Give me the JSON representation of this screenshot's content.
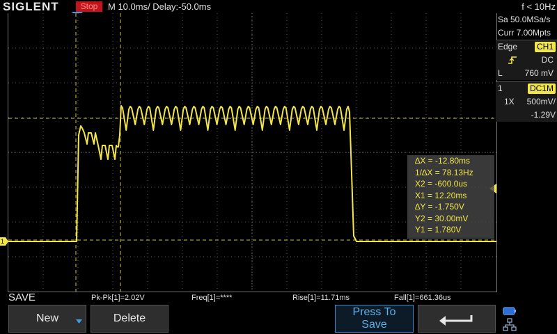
{
  "header": {
    "brand": "SIGLENT",
    "run_status": "Stop",
    "timebase": "M 10.0ms/ Delay:-50.0ms",
    "freq_counter": "f < 10Hz"
  },
  "side_panel": {
    "sample_rate": "Sa 50.0MSa/s",
    "memory_depth": "Curr 7.00Mpts",
    "trigger_type": "Edge",
    "trigger_source": "CH1",
    "trigger_coupling": "DC",
    "trigger_level_label": "L",
    "trigger_level": "760 mV",
    "channel_number": "1",
    "channel_coupling": "DC1M",
    "probe": "1X",
    "volts_per_div": "500mV/",
    "offset": "-1.29V"
  },
  "cursor_readout": {
    "delta_x": "∆X = -12.80ms",
    "inv_delta_x": "1/∆X = 78.13Hz",
    "x2": "X2 = -600.0us",
    "x1": "X1 = 12.20ms",
    "delta_y": "∆Y = -1.750V",
    "y2": "Y2 = 30.00mV",
    "y1": "Y1 = 1.780V"
  },
  "measurements": {
    "pkpk": "Pk-Pk[1]=2.02V",
    "freq": "Freq[1]=****",
    "rise": "Rise[1]=11.71ms",
    "fall": "Fall[1]=661.36us"
  },
  "menu": {
    "title": "SAVE",
    "new_label": "New",
    "delete_label": "Delete",
    "press_to_save_line1": "Press To",
    "press_to_save_line2": "Save"
  },
  "channel_marker": "1",
  "colors": {
    "trace": "#f2e64a",
    "status_bg": "#c2151b",
    "accent_blue": "#3a8fcf"
  },
  "icons": {
    "trigger_position": "down-triangle-icon",
    "edge": "rising-edge-icon",
    "return": "return-arrow-icon",
    "usb": "usb-icon",
    "network": "network-icon"
  }
}
